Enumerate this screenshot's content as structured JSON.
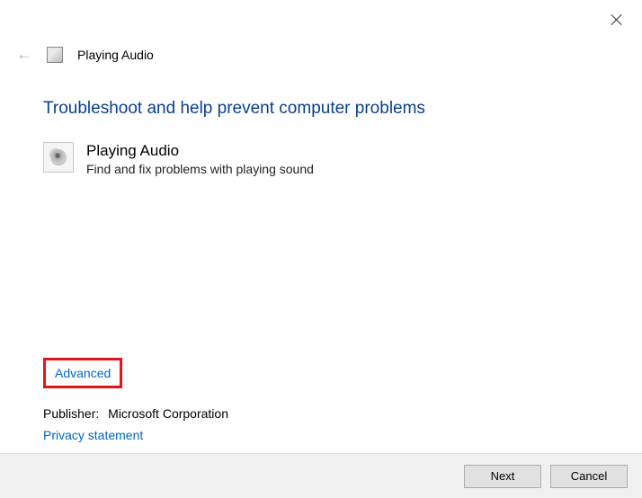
{
  "header": {
    "title": "Playing Audio"
  },
  "wizard": {
    "heading": "Troubleshoot and help prevent computer problems",
    "troubleshooter": {
      "name": "Playing Audio",
      "description": "Find and fix problems with playing sound"
    }
  },
  "links": {
    "advanced": "Advanced",
    "privacy": "Privacy statement"
  },
  "publisher": {
    "label": "Publisher:",
    "value": "Microsoft Corporation"
  },
  "footer": {
    "next": "Next",
    "cancel": "Cancel"
  }
}
